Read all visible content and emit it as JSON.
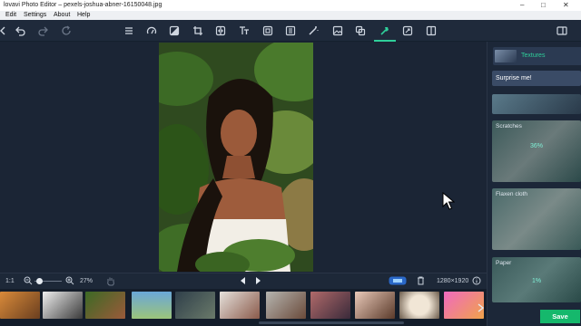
{
  "window": {
    "title": "lovavi Photo Editor – pexels-joshua-abner-16150048.jpg",
    "controls": [
      "–",
      "□",
      "✕"
    ]
  },
  "menu": [
    "Edit",
    "Settings",
    "About",
    "Help"
  ],
  "toolbar": {
    "icons": [
      "undo-icon",
      "redo-icon",
      "reset-icon",
      "menu-icon",
      "enhance-icon",
      "adjust-icon",
      "crop-icon",
      "flip-icon",
      "text-icon",
      "frame-icon",
      "watermark-icon",
      "retouch-icon",
      "image-icon",
      "overlay-icon",
      "effects-icon",
      "resize-icon",
      "compare-icon",
      "panels-icon"
    ],
    "active": "effects-icon"
  },
  "status": {
    "zoom_fit": "1:1",
    "zoom_level": "27%",
    "zoom_slider_value": 0.1,
    "resolution": "1280×1920"
  },
  "panel": {
    "header_label": "Textures",
    "surprise_label": "Surprise me!",
    "textures": [
      {
        "label": "",
        "value": ""
      },
      {
        "label": "Scratches",
        "value": "36%"
      },
      {
        "label": "Flaxen cloth",
        "value": ""
      },
      {
        "label": "Paper",
        "value": "1%"
      }
    ],
    "save_label": "Save"
  },
  "colors": {
    "accent": "#2fcf9a",
    "save": "#15b86c",
    "bg": "#1b2535"
  }
}
